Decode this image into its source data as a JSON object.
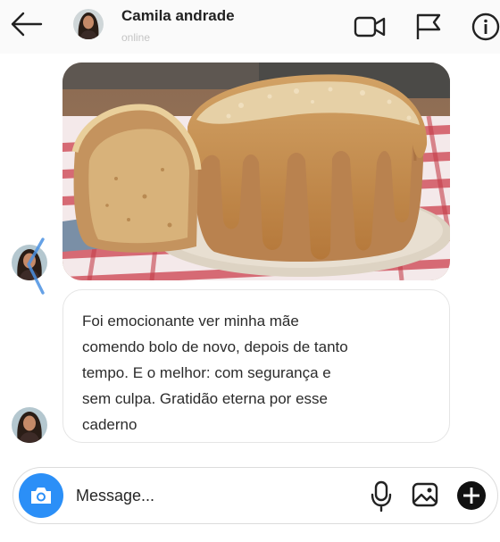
{
  "header": {
    "contact_name": "Camila andrade",
    "status": "online",
    "icons": [
      "back-arrow-icon",
      "video-call-icon",
      "flag-icon",
      "info-icon"
    ]
  },
  "messages": [
    {
      "type": "image",
      "description_icon": "photo-message"
    },
    {
      "type": "text",
      "text": "Foi emocionante ver minha mãe\ncomendo bolo de novo, depois de tanto\ntempo. E o melhor: com segurança e\nsem culpa. Gratidão eterna por esse\ncaderno"
    }
  ],
  "composer": {
    "placeholder": "Message...",
    "value": "",
    "icons": [
      "camera-icon",
      "microphone-icon",
      "gallery-icon",
      "plus-icon"
    ]
  },
  "colors": {
    "accent_blue": "#2b8ff7",
    "header_bg": "#fafafa",
    "border": "#e5e5e5"
  }
}
